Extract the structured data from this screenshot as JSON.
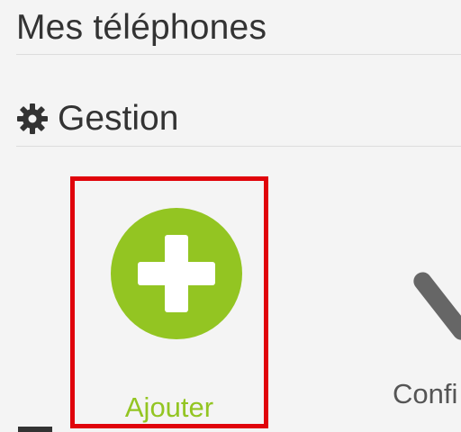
{
  "page": {
    "title": "Mes téléphones"
  },
  "section": {
    "title": "Gestion",
    "icon": "gear-icon"
  },
  "tiles": [
    {
      "label": "Ajouter",
      "icon": "plus-circle-icon",
      "color": "#93c522",
      "highlight_color": "#e0040b"
    },
    {
      "label": "Confi",
      "icon": "wrench-icon",
      "color": "#666666"
    }
  ]
}
